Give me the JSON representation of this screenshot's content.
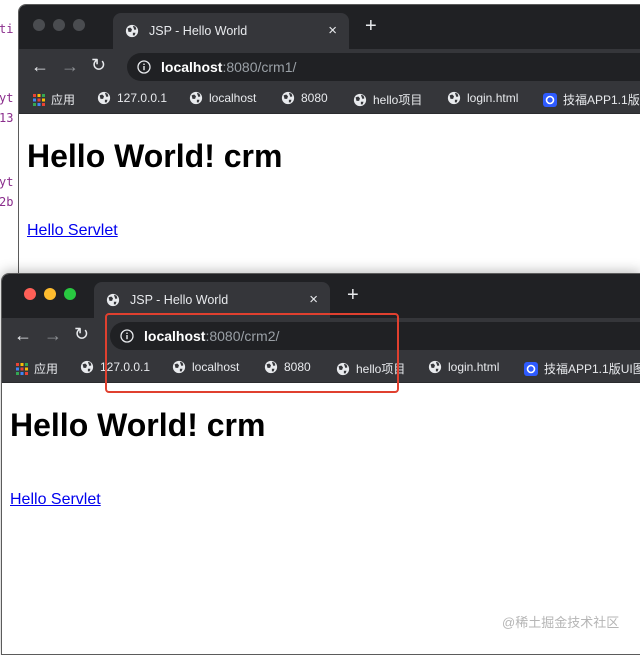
{
  "background_code": {
    "lines": [
      "ti",
      "yt",
      "13",
      "yt",
      "2b"
    ]
  },
  "windows": [
    {
      "tab_title": "JSP - Hello World",
      "close_glyph": "×",
      "new_tab_glyph": "+",
      "url_host": "localhost",
      "url_path": ":8080/crm1/",
      "bookmarks": [
        "应用",
        "127.0.0.1",
        "localhost",
        "8080",
        "hello项目",
        "login.html",
        "技福APP1.1版"
      ],
      "heading": "Hello World! crm",
      "link_text": "Hello Servlet"
    },
    {
      "tab_title": "JSP - Hello World",
      "close_glyph": "×",
      "new_tab_glyph": "+",
      "url_host": "localhost",
      "url_path": ":8080/crm2/",
      "bookmarks": [
        "应用",
        "127.0.0.1",
        "localhost",
        "8080",
        "hello项目",
        "login.html",
        "技福APP1.1版UI图"
      ],
      "heading": "Hello World! crm",
      "link_text": "Hello Servlet"
    }
  ],
  "nav": {
    "back": "←",
    "forward": "→",
    "reload": "↻"
  },
  "watermark": "@稀土掘金技术社区",
  "colors": {
    "highlight": "#e0402f",
    "link": "#0000ee",
    "chrome_dark": "#202124",
    "chrome_toolbar": "#35363a"
  }
}
